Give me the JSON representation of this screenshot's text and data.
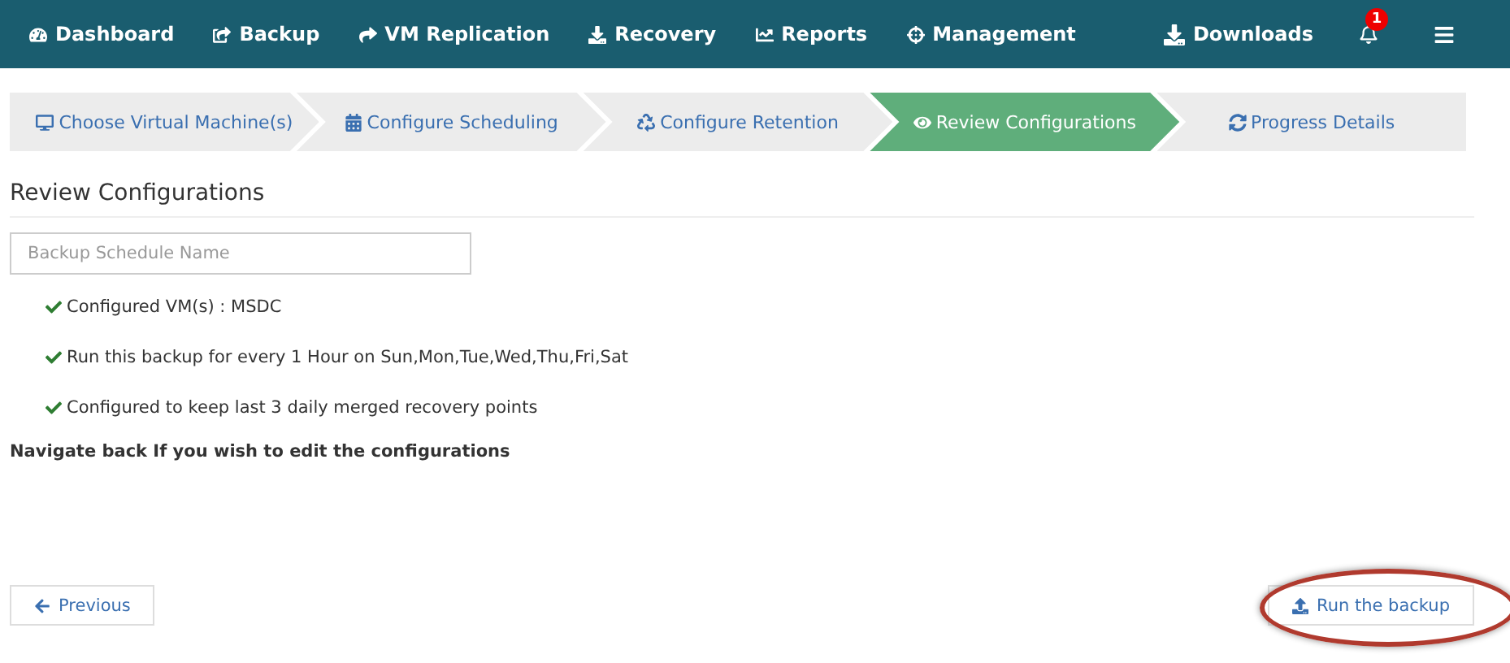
{
  "nav": {
    "items": [
      {
        "label": "Dashboard"
      },
      {
        "label": "Backup"
      },
      {
        "label": "VM Replication"
      },
      {
        "label": "Recovery"
      },
      {
        "label": "Reports"
      },
      {
        "label": "Management"
      }
    ],
    "downloads": "Downloads",
    "notification_count": "1"
  },
  "steps": [
    {
      "label": "Choose Virtual Machine(s)",
      "selected": false
    },
    {
      "label": "Configure Scheduling",
      "selected": false
    },
    {
      "label": "Configure Retention",
      "selected": false
    },
    {
      "label": "Review Configurations",
      "selected": true
    },
    {
      "label": "Progress Details",
      "selected": false
    }
  ],
  "heading": "Review Configurations",
  "schedule_name": {
    "placeholder": "Backup Schedule Name"
  },
  "summary": [
    "Configured VM(s) : MSDC",
    "Run this backup for every 1 Hour on Sun,Mon,Tue,Wed,Thu,Fri,Sat",
    "Configured to keep last 3 daily merged recovery points"
  ],
  "note": "Navigate back If you wish to edit the configurations",
  "buttons": {
    "previous": "Previous",
    "run": "Run the backup"
  }
}
